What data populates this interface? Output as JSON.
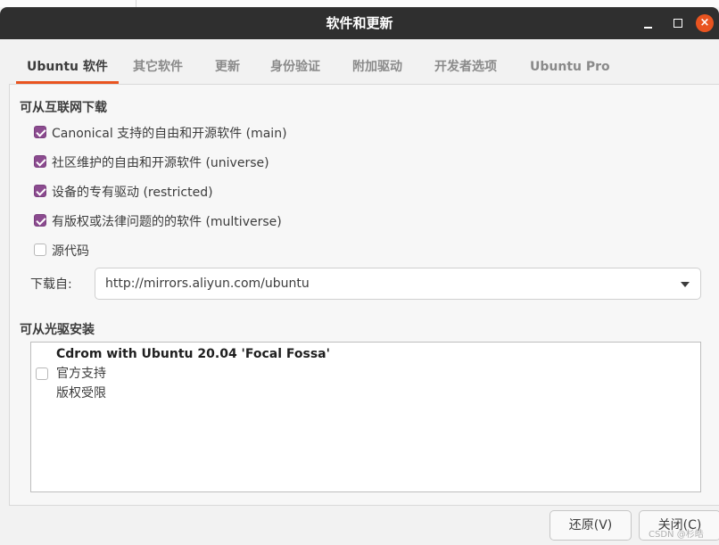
{
  "window": {
    "title": "软件和更新",
    "controls": [
      "minimize-icon",
      "maximize-icon",
      "close-icon"
    ],
    "close_glyph": "×"
  },
  "tabs": [
    {
      "label": "Ubuntu 软件",
      "active": true
    },
    {
      "label": "其它软件",
      "active": false
    },
    {
      "label": "更新",
      "active": false
    },
    {
      "label": "身份验证",
      "active": false
    },
    {
      "label": "附加驱动",
      "active": false
    },
    {
      "label": "开发者选项",
      "active": false
    },
    {
      "label": "Ubuntu Pro",
      "active": false
    }
  ],
  "internet": {
    "heading": "可从互联网下载",
    "options": [
      {
        "label": "Canonical 支持的自由和开源软件 (main)",
        "checked": true
      },
      {
        "label": "社区维护的自由和开源软件 (universe)",
        "checked": true
      },
      {
        "label": "设备的专有驱动 (restricted)",
        "checked": true
      },
      {
        "label": "有版权或法律问题的的软件 (multiverse)",
        "checked": true
      },
      {
        "label": "源代码",
        "checked": false
      }
    ],
    "download_from_label": "下载自:",
    "download_from_value": "http://mirrors.aliyun.com/ubuntu"
  },
  "cdrom": {
    "heading": "可从光驱安装",
    "entry": {
      "checked": false,
      "name": "Cdrom with Ubuntu 20.04 'Focal Fossa'",
      "line2": "官方支持",
      "line3": "版权受限"
    }
  },
  "buttons": {
    "revert": "还原(V)",
    "close": "关闭(C)"
  },
  "watermark": "CSDN @杉皓",
  "colors": {
    "accent": "#e95420",
    "checkbox": "#8b4b8f",
    "titlebar": "#2f2f2f"
  }
}
